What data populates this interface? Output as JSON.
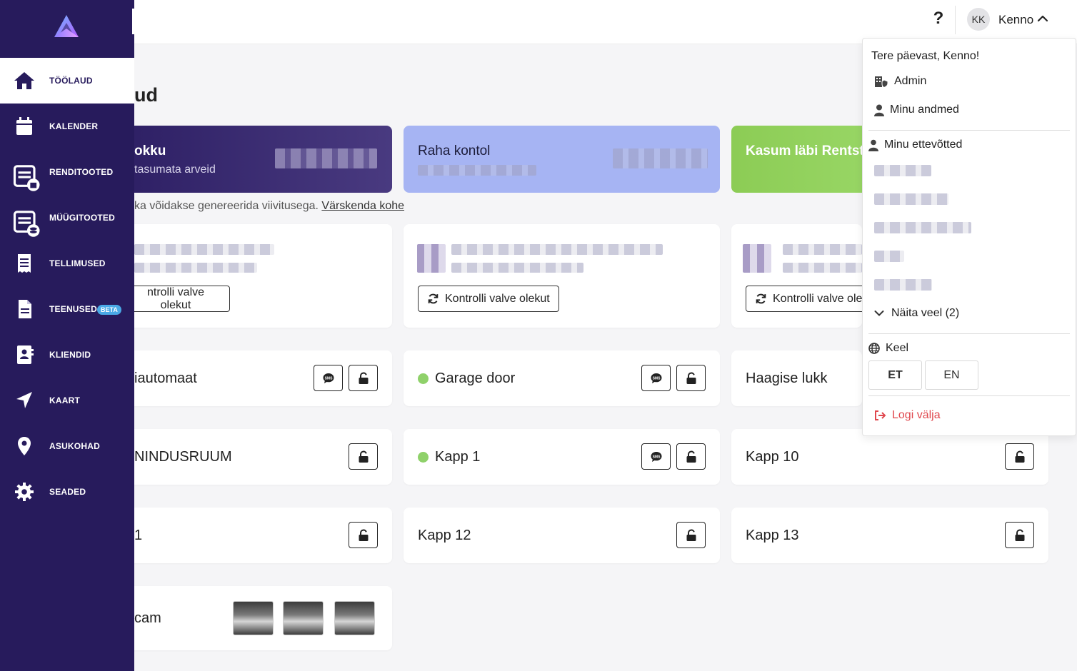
{
  "header": {
    "help_label": "?",
    "user_initials": "KK",
    "user_name": "Kenno"
  },
  "sidebar": {
    "items": [
      {
        "label": "TÖÖLAUD",
        "icon": "home-icon",
        "active": true
      },
      {
        "label": "KALENDER",
        "icon": "calendar-icon"
      },
      {
        "label": "RENDITOOTED",
        "icon": "rental-products-icon"
      },
      {
        "label": "MÜÜGITOOTED",
        "icon": "sale-products-icon"
      },
      {
        "label": "TELLIMUSED",
        "icon": "orders-icon"
      },
      {
        "label": "TEENUSED",
        "icon": "services-icon",
        "badge": "BETA"
      },
      {
        "label": "KLIENDID",
        "icon": "clients-icon"
      },
      {
        "label": "KAART",
        "icon": "map-arrow-icon"
      },
      {
        "label": "ASUKOHAD",
        "icon": "location-pin-icon"
      },
      {
        "label": "SEADED",
        "icon": "settings-gear-icon"
      }
    ]
  },
  "main": {
    "title": "ud",
    "stats": [
      {
        "title": "okku",
        "subtitle": "tasumata arveid",
        "color": "#2c1e63"
      },
      {
        "title": "Raha kontol",
        "color": "#a6b4f3"
      },
      {
        "title": "Kasum läbi Rentst",
        "color": "#8ccc55"
      }
    ],
    "info_text": "ka võidakse genereerida viivitusega.",
    "info_link": "Värskenda kohe",
    "check_buttons": [
      "ntrolli valve olekut",
      "Kontrolli valve olekut",
      "Kontrolli valve ole"
    ],
    "devices": [
      {
        "name": "iautomaat",
        "status": "",
        "sms": true
      },
      {
        "name": "Garage door",
        "status": "online",
        "sms": true
      },
      {
        "name": "Haagise lukk",
        "status": "",
        "sms": false
      },
      {
        "name": "NINDUSRUUM",
        "status": "",
        "sms": false
      },
      {
        "name": "Kapp 1",
        "status": "online",
        "sms": true
      },
      {
        "name": "Kapp 10",
        "status": "",
        "sms": false
      },
      {
        "name": "1",
        "status": "",
        "sms": false
      },
      {
        "name": "Kapp 12",
        "status": "",
        "sms": false
      },
      {
        "name": "Kapp 13",
        "status": "",
        "sms": false
      }
    ],
    "camera": {
      "name": "cam"
    }
  },
  "user_menu": {
    "greeting": "Tere päevast, Kenno!",
    "admin_label": "Admin",
    "my_data_label": "Minu andmed",
    "companies_label": "Minu ettevõtted",
    "show_more_label": "Näita veel (2)",
    "language_label": "Keel",
    "languages": [
      "ET",
      "EN"
    ],
    "selected_language": "ET",
    "logout_label": "Logi välja",
    "logout_color": "#e0484e"
  },
  "colors": {
    "sidebar": "#271b5c",
    "status_online": "#8fd16a"
  }
}
